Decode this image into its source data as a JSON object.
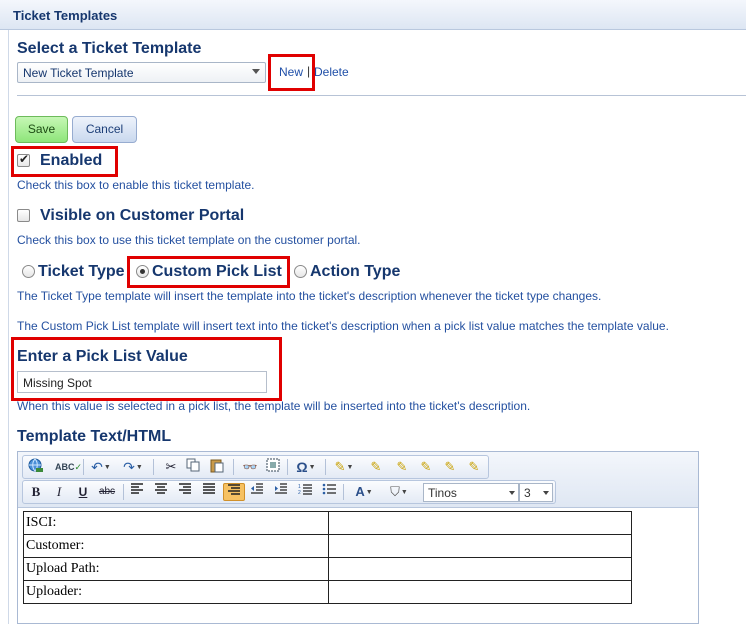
{
  "panel": {
    "title": "Ticket Templates"
  },
  "select_section": {
    "heading": "Select a Ticket Template",
    "selected": "New Ticket Template",
    "new_label": "New",
    "separator": "|",
    "delete_label": "Delete"
  },
  "actions": {
    "save_label": "Save",
    "cancel_label": "Cancel"
  },
  "enabled": {
    "label": "Enabled",
    "checked": true,
    "help": "Check this box to enable this ticket template."
  },
  "portal": {
    "label": "Visible on Customer Portal",
    "checked": false,
    "help": "Check this box to use this ticket template on the customer portal."
  },
  "template_type": {
    "options": [
      {
        "label": "Ticket Type",
        "selected": false
      },
      {
        "label": "Custom Pick List",
        "selected": true
      },
      {
        "label": "Action Type",
        "selected": false
      }
    ],
    "help_ticket_type": "The Ticket Type template will insert the template into the ticket's description whenever the ticket type changes.",
    "help_pick_list": "The Custom Pick List template will insert text into the ticket's description when a pick list value matches the template value."
  },
  "pick_list": {
    "heading": "Enter a Pick List Value",
    "value": "Missing Spot",
    "help": "When this value is selected in a pick list, the template will be inserted into the ticket's description."
  },
  "editor": {
    "heading": "Template Text/HTML",
    "font_family": "Tinos",
    "font_size": "3",
    "toolbar_row1_icons": [
      "link-globe-icon",
      "spellcheck-icon",
      "undo-icon",
      "redo-icon",
      "cut-icon",
      "copy-icon",
      "paste-icon",
      "find-icon",
      "select-all-icon",
      "special-char-icon",
      "style-brush-icon",
      "paste-text-icon",
      "paste-word-icon",
      "paste-html-icon",
      "clean-html-icon",
      "cleanup-icon"
    ],
    "toolbar_row2_icons": [
      "bold-icon",
      "italic-icon",
      "underline-icon",
      "strikethrough-icon",
      "align-left-icon",
      "align-center-icon",
      "align-right-icon",
      "justify-icon",
      "rtl-icon",
      "outdent-icon",
      "indent-icon",
      "numbered-list-icon",
      "bullet-list-icon",
      "font-color-icon",
      "highlight-icon"
    ],
    "table_rows": [
      {
        "label": "ISCI:",
        "value": ""
      },
      {
        "label": "Customer:",
        "value": ""
      },
      {
        "label": "Upload Path:",
        "value": ""
      },
      {
        "label": "Uploader:",
        "value": ""
      }
    ]
  },
  "colors": {
    "annotation_red": "#e00000",
    "save_green": "#8ee57a",
    "heading_blue": "#16376e"
  }
}
